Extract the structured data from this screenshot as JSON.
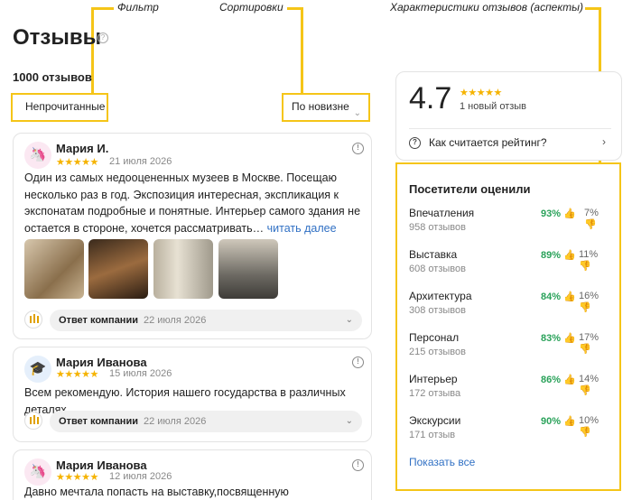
{
  "annotations": {
    "filter": "Фильтр",
    "sorting": "Сортировки",
    "aspects": "Характеристики отзывов (аспекты)"
  },
  "header": {
    "title": "Отзывы",
    "help_icon": "question-circle-icon",
    "count": "1000 отзывов"
  },
  "controls": {
    "filter_label": "Непрочитанные",
    "sort_label": "По новизне"
  },
  "reviews": [
    {
      "author": "Мария И.",
      "avatar_icon": "unicorn-icon",
      "stars": "★★★★★",
      "date": "21 июля 2026",
      "text": "Один из самых недооцененных музеев в Москве. Посещаю несколько раз в год. Экспозиция интересная, экспликация к экспонатам подробные и понятные. Интерьер самого здания не остается в стороне, хочется рассматривать…",
      "more": "читать далее",
      "reply_label": "Ответ компании",
      "reply_date": "22 июля 2026"
    },
    {
      "author": "Мария Иванова",
      "avatar_icon": "graduation-cap-icon",
      "stars": "★★★★★",
      "date": "15 июля 2026",
      "text": "Всем рекомендую. История нашего государства в различных деталях",
      "reply_label": "Ответ компании",
      "reply_date": "22 июля 2026"
    },
    {
      "author": "Мария Иванова",
      "avatar_icon": "unicorn-icon",
      "stars": "★★★★★",
      "date": "12 июля 2026",
      "text": "Давно мечтала попасть на выставку,посвященную"
    }
  ],
  "rating": {
    "value": "4.7",
    "stars": "★★★★★",
    "new_reviews": "1 новый отзыв",
    "how_calculated": "Как считается рейтинг?"
  },
  "aspects": {
    "title": "Посетители оценили",
    "items": [
      {
        "name": "Впечатления",
        "count": "958 отзывов",
        "pos": "93%",
        "neg": "7%"
      },
      {
        "name": "Выставка",
        "count": "608 отзывов",
        "pos": "89%",
        "neg": "11%"
      },
      {
        "name": "Архитектура",
        "count": "308 отзывов",
        "pos": "84%",
        "neg": "16%"
      },
      {
        "name": "Персонал",
        "count": "215 отзывов",
        "pos": "83%",
        "neg": "17%"
      },
      {
        "name": "Интерьер",
        "count": "172 отзыва",
        "pos": "86%",
        "neg": "14%"
      },
      {
        "name": "Экскурсии",
        "count": "171 отзыв",
        "pos": "90%",
        "neg": "10%"
      }
    ],
    "show_all": "Показать все"
  },
  "colors": {
    "annotation": "#f5c518",
    "positive": "#2aa25a",
    "link": "#3070c4",
    "stars": "#f5b301"
  }
}
